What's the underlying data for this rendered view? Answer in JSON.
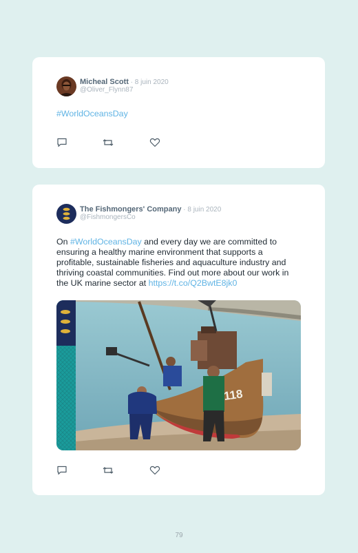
{
  "tweets": [
    {
      "author": "Micheal Scott",
      "date": " · 8 juin 2020",
      "handle": "@Oliver_Flynn87",
      "hashtag": "#WorldOceansDay"
    },
    {
      "author": "The Fishmongers' Company",
      "date": " · 8 juin 2020",
      "handle": "@FishmongersCo",
      "text_prefix": "On ",
      "hashtag": "#WorldOceansDay",
      "text_body": " and every day we are committed to ensuring a healthy marine environment that supports a profitable, sustainable fisheries and aquaculture industry and thriving coastal communities. Find out more about our work in the UK marine sector at ",
      "url": "https://t.co/Q2BwtE8jk0",
      "boat_number": "118"
    }
  ],
  "icons": {
    "reply": "reply-icon",
    "retweet": "retweet-icon",
    "like": "heart-icon"
  },
  "colors": {
    "background": "#dff0ef",
    "link": "#5fb3e4",
    "crest_navy": "#1d2d5c",
    "crest_teal": "#1a9b9b"
  },
  "page_number": "79"
}
